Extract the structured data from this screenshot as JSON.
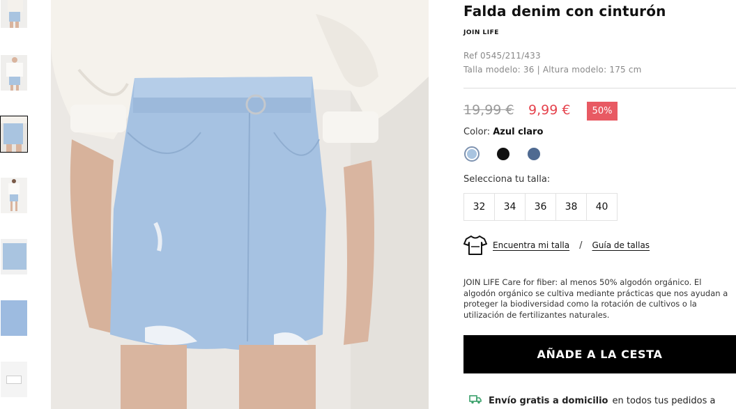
{
  "product": {
    "title": "Falda denim con cinturón",
    "brand": "JOIN LIFE",
    "ref": "Ref 0545/211/433",
    "model_info": "Talla modelo: 36 | Altura modelo: 175 cm"
  },
  "price": {
    "old": "19,99 €",
    "new": "9,99 €",
    "discount": "50%",
    "old_color": "#999999",
    "new_color": "#e5434d",
    "badge_color": "#e85a63"
  },
  "color": {
    "label": "Color: ",
    "selected": "Azul claro",
    "swatches": [
      {
        "name": "light-blue-denim",
        "hex": "#a9c4e0",
        "selected": true
      },
      {
        "name": "black",
        "hex": "#111111",
        "selected": false
      },
      {
        "name": "dark-blue-denim",
        "hex": "#4f6a91",
        "selected": false
      }
    ]
  },
  "sizes": {
    "label": "Selecciona tu talla:",
    "options": [
      "32",
      "34",
      "36",
      "38",
      "40"
    ]
  },
  "fit": {
    "icon": "tshirt-icon",
    "find_size": "Encuentra mi talla",
    "separator": "/",
    "size_guide": "Guía de tallas"
  },
  "description": "JOIN LIFE Care for fiber: al menos 50% algodón orgánico. El algodón orgánico se cultiva mediante prácticas que nos ayudan a proteger la biodiversidad como la rotación de cultivos o la utilización de fertilizantes naturales.",
  "add_to_cart": "AÑADE A LA CESTA",
  "shipping": {
    "icon": "truck-icon",
    "bold": "Envío gratis a domicilio",
    "rest": "en todos tus pedidos a"
  },
  "thumbnails": [
    {
      "name": "thumb-1"
    },
    {
      "name": "thumb-2"
    },
    {
      "name": "thumb-3",
      "active": true
    },
    {
      "name": "thumb-4"
    },
    {
      "name": "thumb-5"
    },
    {
      "name": "thumb-6"
    },
    {
      "name": "thumb-7"
    }
  ]
}
